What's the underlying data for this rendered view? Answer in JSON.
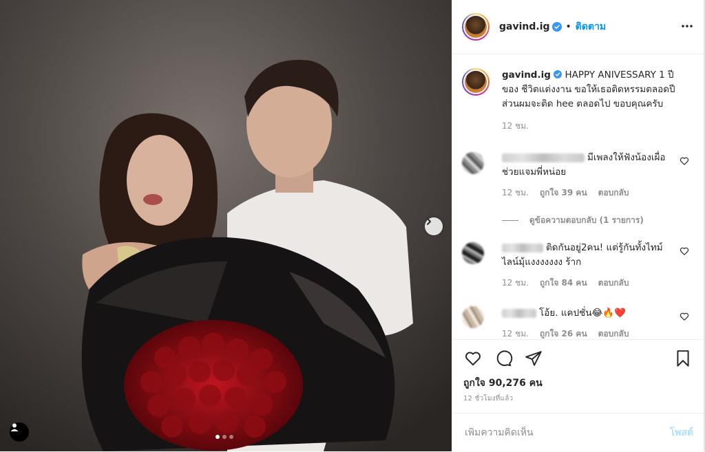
{
  "post": {
    "author": "gavind.ig",
    "follow_label": "ติดตาม",
    "caption": "HAPPY ANIVESSARY 1 ปี ของ ชีวิตแต่งงาน ขอให้เธอติดหรรมตลอดปี ส่วนผมจะติด hee ตลอดไป ขอบคุณครับ",
    "caption_time": "12 ชม.",
    "likes_text": "ถูกใจ 90,276 คน",
    "timestamp": "12 ชั่วโมงที่แล้ว",
    "carousel_total": 3,
    "carousel_index": 1
  },
  "comments": [
    {
      "text": "มีเพลงให้ฟังน้องเผื่อช่วยแจมพี่หน่อย",
      "time": "12 ชม.",
      "likes": "ถูกใจ 39 คน",
      "reply": "ตอบกลับ"
    },
    {
      "text": "ติดกันอยู่2คน! แต่รู้กันทั้งไทม์ไลน์มุ้แงงงงงงง ร้าก",
      "time": "12 ชม.",
      "likes": "ถูกใจ 84 คน",
      "reply": "ตอบกลับ"
    },
    {
      "text": "โอ้ย. แคปชั่น😂🔥❤️",
      "time": "12 ชม.",
      "likes": "ถูกใจ 26 คน",
      "reply": "ตอบกลับ"
    }
  ],
  "view_replies": "ดูข้อความตอบกลับ (1 รายการ)",
  "add_comment": {
    "placeholder": "เพิ่มความคิดเห็น",
    "post_label": "โพสต์"
  },
  "colors": {
    "accent": "#0095f6",
    "verified": "#3897f0",
    "text": "#262626",
    "muted": "#8e8e8e"
  },
  "icons": [
    "more-icon",
    "heart-icon",
    "comment-icon",
    "share-icon",
    "bookmark-icon",
    "verified-icon",
    "user-tag-icon",
    "chevron-right-icon"
  ]
}
